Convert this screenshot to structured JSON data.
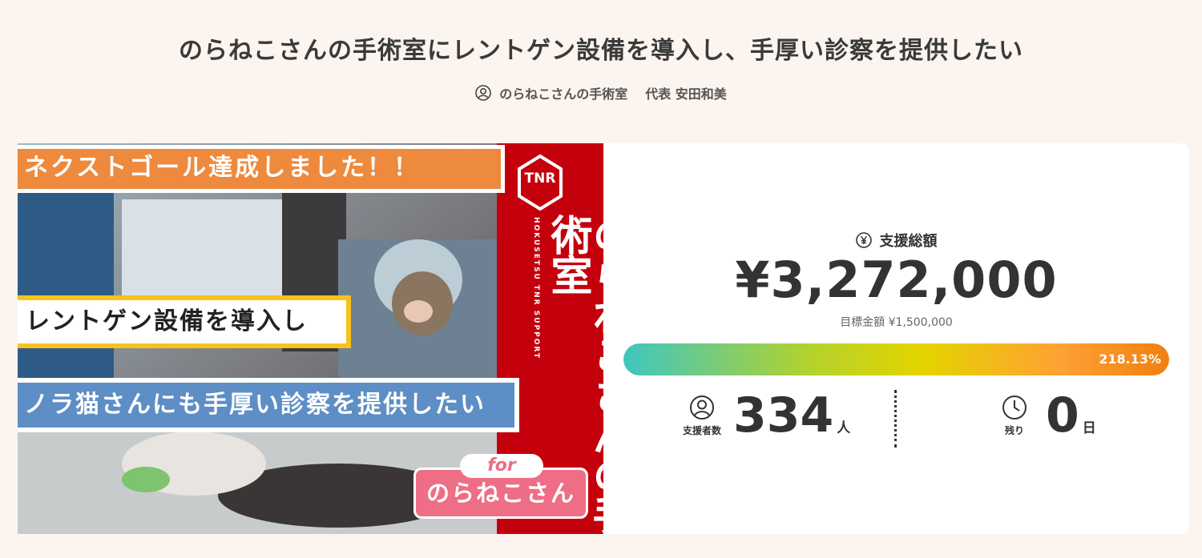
{
  "project": {
    "title": "のらねこさんの手術室にレントゲン設備を導入し、手厚い診察を提供したい",
    "owner": "のらねこさんの手術室",
    "representative": "代表 安田和美"
  },
  "hero": {
    "banner_top": "ネクストゴール達成しました！！",
    "banner_middle": "レントゲン設備を導入し",
    "banner_bottom": "ノラ猫さんにも手厚い診察を提供したい",
    "band_logo_text": "TNR",
    "band_subtitle": "HOKUSETSU TNR SUPPORT",
    "band_name": "のらねこさんの手術室",
    "for_label": "for",
    "for_name": "のらねこさん"
  },
  "stats": {
    "total_label": "支援総額",
    "total_amount": "¥3,272,000",
    "goal_text": "目標金額 ¥1,500,000",
    "progress_text": "218.13%",
    "progress_fraction": 1.0,
    "supporters_label": "支援者数",
    "supporters_value": "334",
    "supporters_unit": "人",
    "remaining_label": "残り",
    "remaining_value": "0",
    "remaining_unit": "日"
  },
  "icons": {
    "owner": "person-circle-icon",
    "total": "yen-circle-icon",
    "supporters": "person-circle-icon",
    "remaining": "clock-icon"
  },
  "colors": {
    "background": "#fbf4ef",
    "band_red": "#c4000c",
    "banner_orange": "#ee8a3d",
    "banner_blue": "#5d8ec5",
    "banner_yellow_border": "#f7c21c",
    "pink": "#ee6e86",
    "progress_start": "#3fc6c0",
    "progress_end": "#f07f10"
  }
}
